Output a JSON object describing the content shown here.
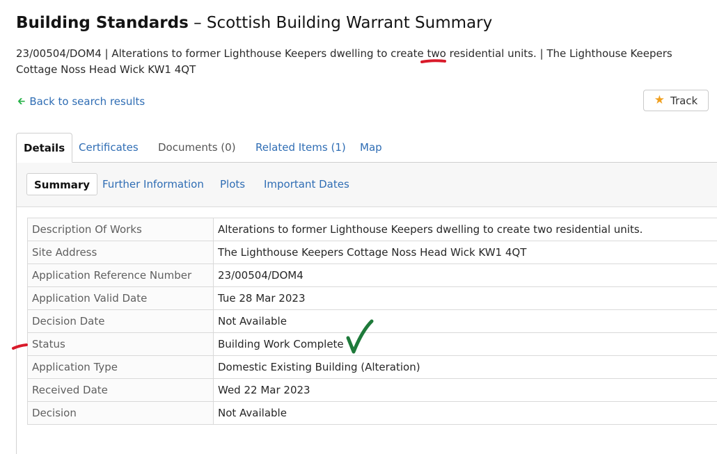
{
  "header": {
    "title_strong": "Building Standards",
    "title_rest": " – Scottish Building Warrant Summary",
    "subtitle": "23/00504/DOM4 | Alterations to former Lighthouse Keepers dwelling to create two residential units. | The Lighthouse Keepers Cottage Noss Head Wick KW1 4QT"
  },
  "nav": {
    "back_label": "Back to search results",
    "back_icon": "arrow-left-icon",
    "track_label": "Track",
    "track_icon": "star-icon"
  },
  "tabs": [
    {
      "label": "Details",
      "active": true
    },
    {
      "label": "Certificates",
      "active": false
    },
    {
      "label": "Documents (0)",
      "active": false
    },
    {
      "label": "Related Items (1)",
      "active": false
    },
    {
      "label": "Map",
      "active": false
    }
  ],
  "subtabs": [
    {
      "label": "Summary",
      "active": true
    },
    {
      "label": "Further Information",
      "active": false
    },
    {
      "label": "Plots",
      "active": false
    },
    {
      "label": "Important Dates",
      "active": false
    }
  ],
  "summary_rows": [
    {
      "label": "Description Of Works",
      "value": "Alterations to former Lighthouse Keepers dwelling to create two residential units."
    },
    {
      "label": "Site Address",
      "value": "The Lighthouse Keepers Cottage Noss Head Wick KW1 4QT"
    },
    {
      "label": "Application Reference Number",
      "value": "23/00504/DOM4"
    },
    {
      "label": "Application Valid Date",
      "value": "Tue 28 Mar 2023"
    },
    {
      "label": "Decision Date",
      "value": "Not Available"
    },
    {
      "label": "Status",
      "value": "Building Work Complete"
    },
    {
      "label": "Application Type",
      "value": "Domestic Existing Building (Alteration)"
    },
    {
      "label": "Received Date",
      "value": "Wed 22 Mar 2023"
    },
    {
      "label": "Decision",
      "value": "Not Available"
    }
  ],
  "colors": {
    "link": "#2f6db4",
    "back_arrow": "#29b34a",
    "star": "#f0a020",
    "annotation_red": "#d91a2a",
    "annotation_green": "#1e7a3a"
  }
}
